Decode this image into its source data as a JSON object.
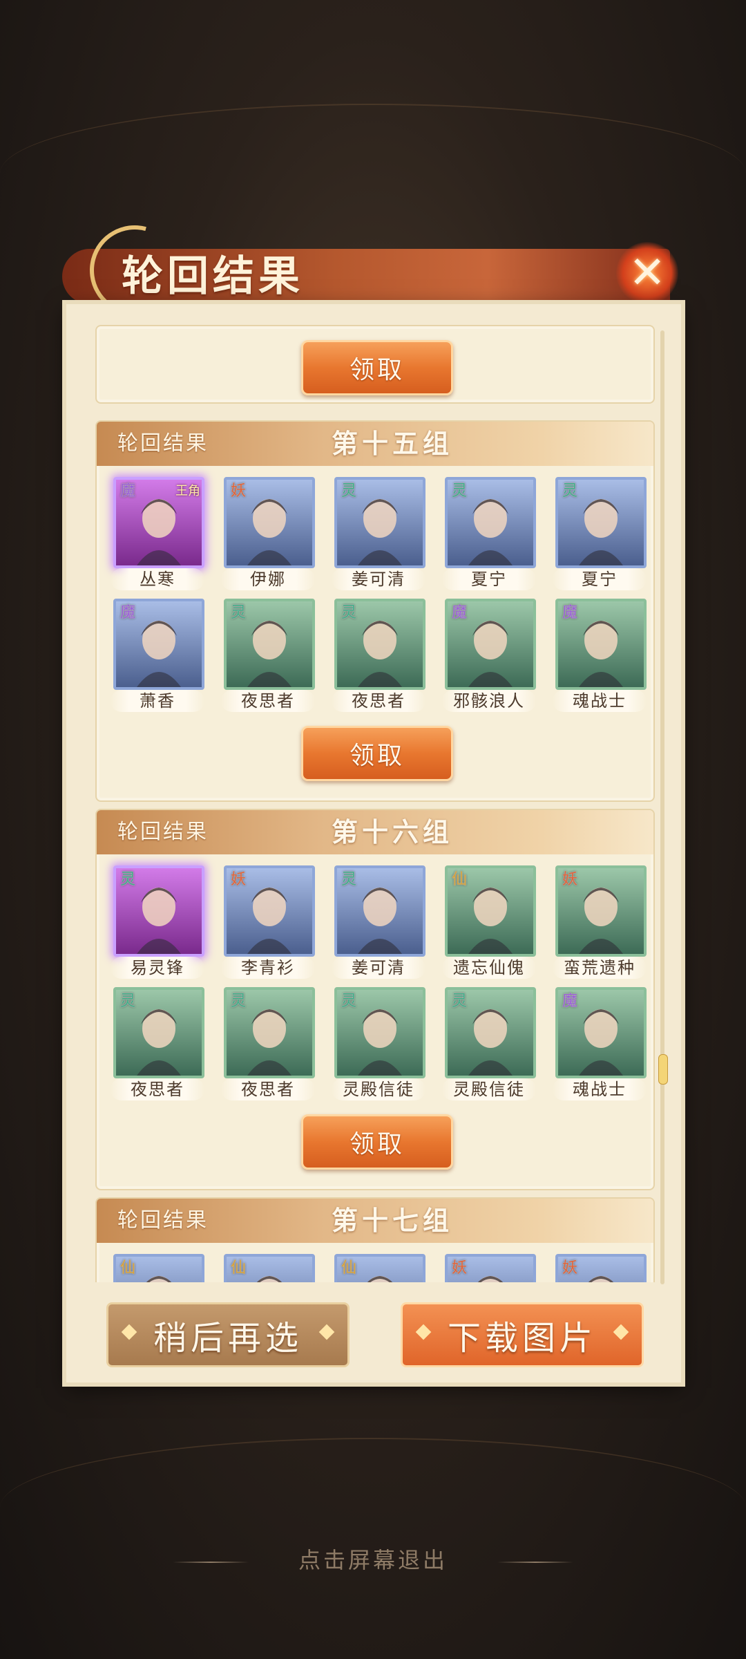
{
  "dialog": {
    "title": "轮回结果",
    "close_icon": "close-icon"
  },
  "top_card": {
    "claim_label": "领取"
  },
  "groups": [
    {
      "header_label": "轮回结果",
      "group_name": "第十五组",
      "claim_label": "领取",
      "heroes": [
        {
          "name": "丛寒",
          "faction": "魔",
          "king": "王角",
          "frame": "purple"
        },
        {
          "name": "伊娜",
          "faction": "妖",
          "frame": "blue"
        },
        {
          "name": "姜可清",
          "faction": "灵",
          "frame": "blue"
        },
        {
          "name": "夏宁",
          "faction": "灵",
          "frame": "blue"
        },
        {
          "name": "夏宁",
          "faction": "灵",
          "frame": "blue"
        },
        {
          "name": "萧香",
          "faction": "魔",
          "frame": "blue"
        },
        {
          "name": "夜思者",
          "faction": "灵",
          "frame": "green"
        },
        {
          "name": "夜思者",
          "faction": "灵",
          "frame": "green"
        },
        {
          "name": "邪骸浪人",
          "faction": "魔",
          "frame": "green"
        },
        {
          "name": "魂战士",
          "faction": "魔",
          "frame": "green"
        }
      ]
    },
    {
      "header_label": "轮回结果",
      "group_name": "第十六组",
      "claim_label": "领取",
      "heroes": [
        {
          "name": "易灵锋",
          "faction": "灵",
          "frame": "purple"
        },
        {
          "name": "李青衫",
          "faction": "妖",
          "frame": "blue"
        },
        {
          "name": "姜可清",
          "faction": "灵",
          "frame": "blue"
        },
        {
          "name": "遗忘仙傀",
          "faction": "仙",
          "frame": "green"
        },
        {
          "name": "蛮荒遗种",
          "faction": "妖",
          "frame": "green"
        },
        {
          "name": "夜思者",
          "faction": "灵",
          "frame": "green"
        },
        {
          "name": "夜思者",
          "faction": "灵",
          "frame": "green"
        },
        {
          "name": "灵殿信徒",
          "faction": "灵",
          "frame": "green"
        },
        {
          "name": "灵殿信徒",
          "faction": "灵",
          "frame": "green"
        },
        {
          "name": "魂战士",
          "faction": "魔",
          "frame": "green"
        }
      ]
    },
    {
      "header_label": "轮回结果",
      "group_name": "第十七组",
      "heroes": [
        {
          "faction": "仙",
          "frame": "blue"
        },
        {
          "faction": "仙",
          "frame": "blue"
        },
        {
          "faction": "仙",
          "frame": "blue"
        },
        {
          "faction": "妖",
          "frame": "blue"
        },
        {
          "faction": "妖",
          "frame": "blue"
        }
      ]
    }
  ],
  "actions": {
    "later_label": "稍后再选",
    "download_label": "下载图片"
  },
  "exit_hint": "点击屏幕退出",
  "colors": {
    "accent": "#e8772f",
    "panel": "#f4ead2",
    "text_dark": "#4c3a2c"
  }
}
